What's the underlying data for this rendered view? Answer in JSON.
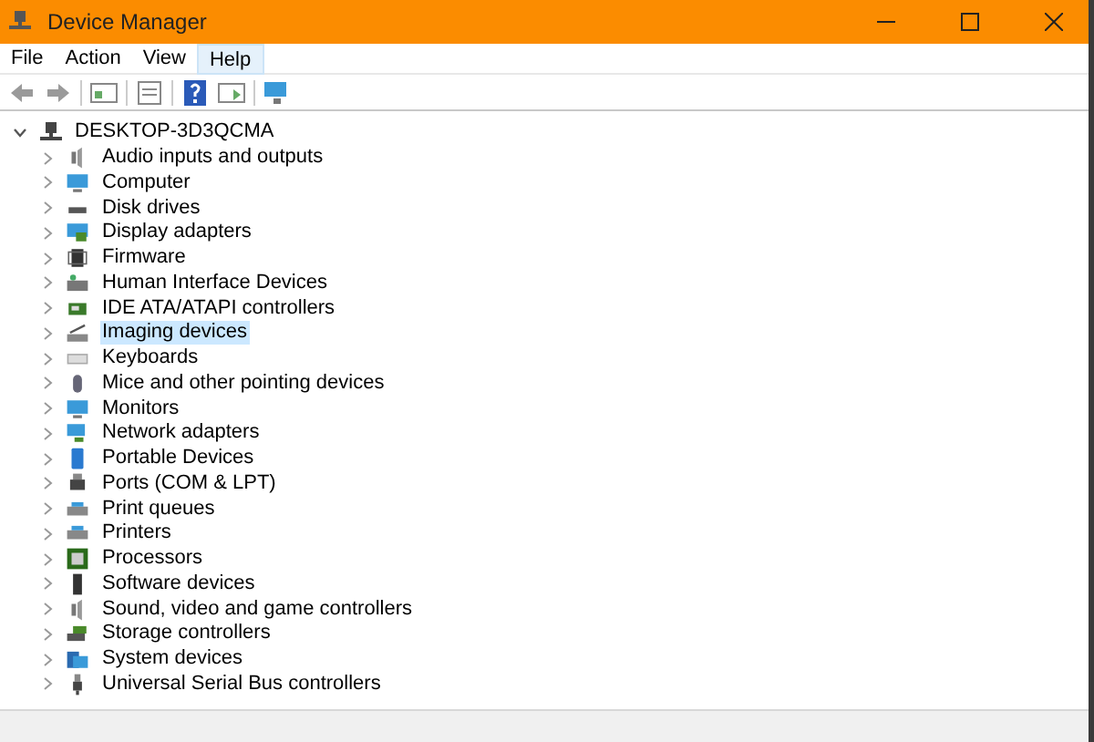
{
  "window": {
    "title": "Device Manager"
  },
  "menu": [
    {
      "label": "File",
      "selected": false
    },
    {
      "label": "Action",
      "selected": false
    },
    {
      "label": "View",
      "selected": false
    },
    {
      "label": "Help",
      "selected": true
    }
  ],
  "tree": {
    "label": "DESKTOP-3D3QCMA",
    "expanded": true,
    "children": [
      {
        "label": "Audio inputs and outputs",
        "expanded": false,
        "selected": false
      },
      {
        "label": "Computer",
        "expanded": false,
        "selected": false
      },
      {
        "label": "Disk drives",
        "expanded": false,
        "selected": false
      },
      {
        "label": "Display adapters",
        "expanded": false,
        "selected": false
      },
      {
        "label": "Firmware",
        "expanded": false,
        "selected": false
      },
      {
        "label": "Human Interface Devices",
        "expanded": false,
        "selected": false
      },
      {
        "label": "IDE ATA/ATAPI controllers",
        "expanded": false,
        "selected": false
      },
      {
        "label": "Imaging devices",
        "expanded": false,
        "selected": true
      },
      {
        "label": "Keyboards",
        "expanded": false,
        "selected": false
      },
      {
        "label": "Mice and other pointing devices",
        "expanded": false,
        "selected": false
      },
      {
        "label": "Monitors",
        "expanded": false,
        "selected": false
      },
      {
        "label": "Network adapters",
        "expanded": false,
        "selected": false
      },
      {
        "label": "Portable Devices",
        "expanded": false,
        "selected": false
      },
      {
        "label": "Ports (COM & LPT)",
        "expanded": false,
        "selected": false
      },
      {
        "label": "Print queues",
        "expanded": false,
        "selected": false
      },
      {
        "label": "Printers",
        "expanded": false,
        "selected": false
      },
      {
        "label": "Processors",
        "expanded": false,
        "selected": false
      },
      {
        "label": "Software devices",
        "expanded": false,
        "selected": false
      },
      {
        "label": "Sound, video and game controllers",
        "expanded": false,
        "selected": false
      },
      {
        "label": "Storage controllers",
        "expanded": false,
        "selected": false
      },
      {
        "label": "System devices",
        "expanded": false,
        "selected": false
      },
      {
        "label": "Universal Serial Bus controllers",
        "expanded": false,
        "selected": false
      }
    ]
  }
}
